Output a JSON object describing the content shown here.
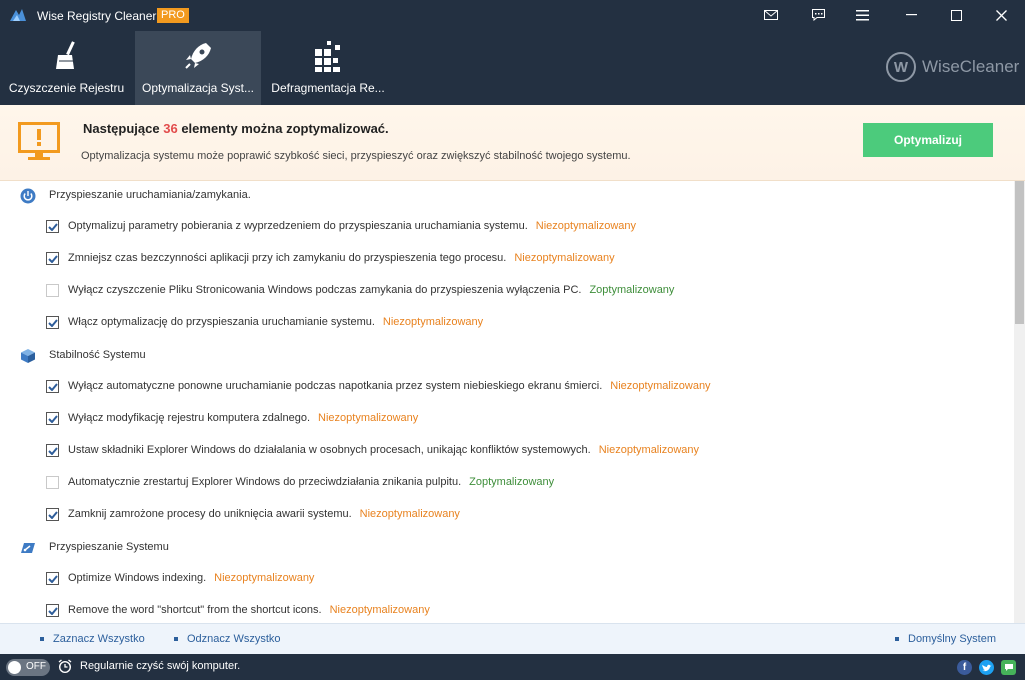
{
  "window": {
    "title": "Wise Registry Cleaner X",
    "badge": "PRO",
    "controls": [
      "mail-icon",
      "feedback-icon",
      "menu-icon",
      "minimize-icon",
      "maximize-icon",
      "close-icon"
    ]
  },
  "tabs": [
    {
      "label": "Czyszczenie Rejestru",
      "icon": "broom-icon",
      "active": false
    },
    {
      "label": "Optymalizacja Syst...",
      "icon": "rocket-icon",
      "active": true
    },
    {
      "label": "Defragmentacja Re...",
      "icon": "defrag-icon",
      "active": false
    }
  ],
  "brand": {
    "letter": "W",
    "name": "WiseCleaner"
  },
  "banner": {
    "heading_prefix": "Następujące",
    "count": "36",
    "heading_suffix": "elementy można zoptymalizować.",
    "description": "Optymalizacja systemu może poprawić szybkość sieci, przyspieszyć oraz zwiększyć stabilność twojego systemu.",
    "button": "Optymalizuj"
  },
  "sections": [
    {
      "title": "Przyspieszanie uruchamiania/zamykania.",
      "icon": "power-icon",
      "items": [
        {
          "text": "Optymalizuj parametry pobierania z wyprzedzeniem do przyspieszania uruchamiania systemu.",
          "status": "Niezoptymalizowany",
          "checked": true
        },
        {
          "text": "Zmniejsz czas bezczynności aplikacji przy ich zamykaniu do przyspieszenia tego procesu.",
          "status": "Niezoptymalizowany",
          "checked": true
        },
        {
          "text": "Wyłącz czyszczenie Pliku Stronicowania Windows podczas zamykania do przyspieszenia wyłączenia PC.",
          "status": "Zoptymalizowany",
          "checked": false
        },
        {
          "text": "Włącz optymalizację do przyspieszania uruchamianie systemu.",
          "status": "Niezoptymalizowany",
          "checked": true
        }
      ]
    },
    {
      "title": "Stabilność Systemu",
      "icon": "cube-icon",
      "items": [
        {
          "text": "Wyłącz automatyczne ponowne uruchamianie podczas napotkania przez system niebieskiego ekranu śmierci.",
          "status": "Niezoptymalizowany",
          "checked": true
        },
        {
          "text": "Wyłącz modyfikację rejestru komputera zdalnego.",
          "status": "Niezoptymalizowany",
          "checked": true
        },
        {
          "text": "Ustaw składniki Explorer Windows do działalania w osobnych procesach, unikając konfliktów systemowych.",
          "status": "Niezoptymalizowany",
          "checked": true
        },
        {
          "text": "Automatycznie zrestartuj Explorer Windows do przeciwdziałania znikania pulpitu.",
          "status": "Zoptymalizowany",
          "checked": false
        },
        {
          "text": "Zamknij zamrożone procesy do uniknięcia awarii systemu.",
          "status": "Niezoptymalizowany",
          "checked": true
        }
      ]
    },
    {
      "title": "Przyspieszanie Systemu",
      "icon": "speed-icon",
      "items": [
        {
          "text": "Optimize Windows indexing.",
          "status": "Niezoptymalizowany",
          "checked": true
        },
        {
          "text": "Remove the word \"shortcut\" from the shortcut icons.",
          "status": "Niezoptymalizowany",
          "checked": true
        }
      ]
    }
  ],
  "actions": {
    "select_all": "Zaznacz Wszystko",
    "deselect_all": "Odznacz Wszystko",
    "default": "Domyślny System"
  },
  "statusbar": {
    "toggle_label": "OFF",
    "toggle_on": false,
    "text": "Regularnie czyść swój komputer.",
    "social": [
      "facebook-icon",
      "twitter-icon",
      "chat-icon"
    ]
  },
  "colors": {
    "header_bg": "#233041",
    "active_tab_bg": "#3b4858",
    "accent_orange": "#f29a1f",
    "count_red": "#e24c4c",
    "button_green": "#4ccb7c",
    "status_not_optimized": "#e8821f",
    "status_optimized": "#3e8e3a",
    "link_blue": "#2c5f9c"
  }
}
